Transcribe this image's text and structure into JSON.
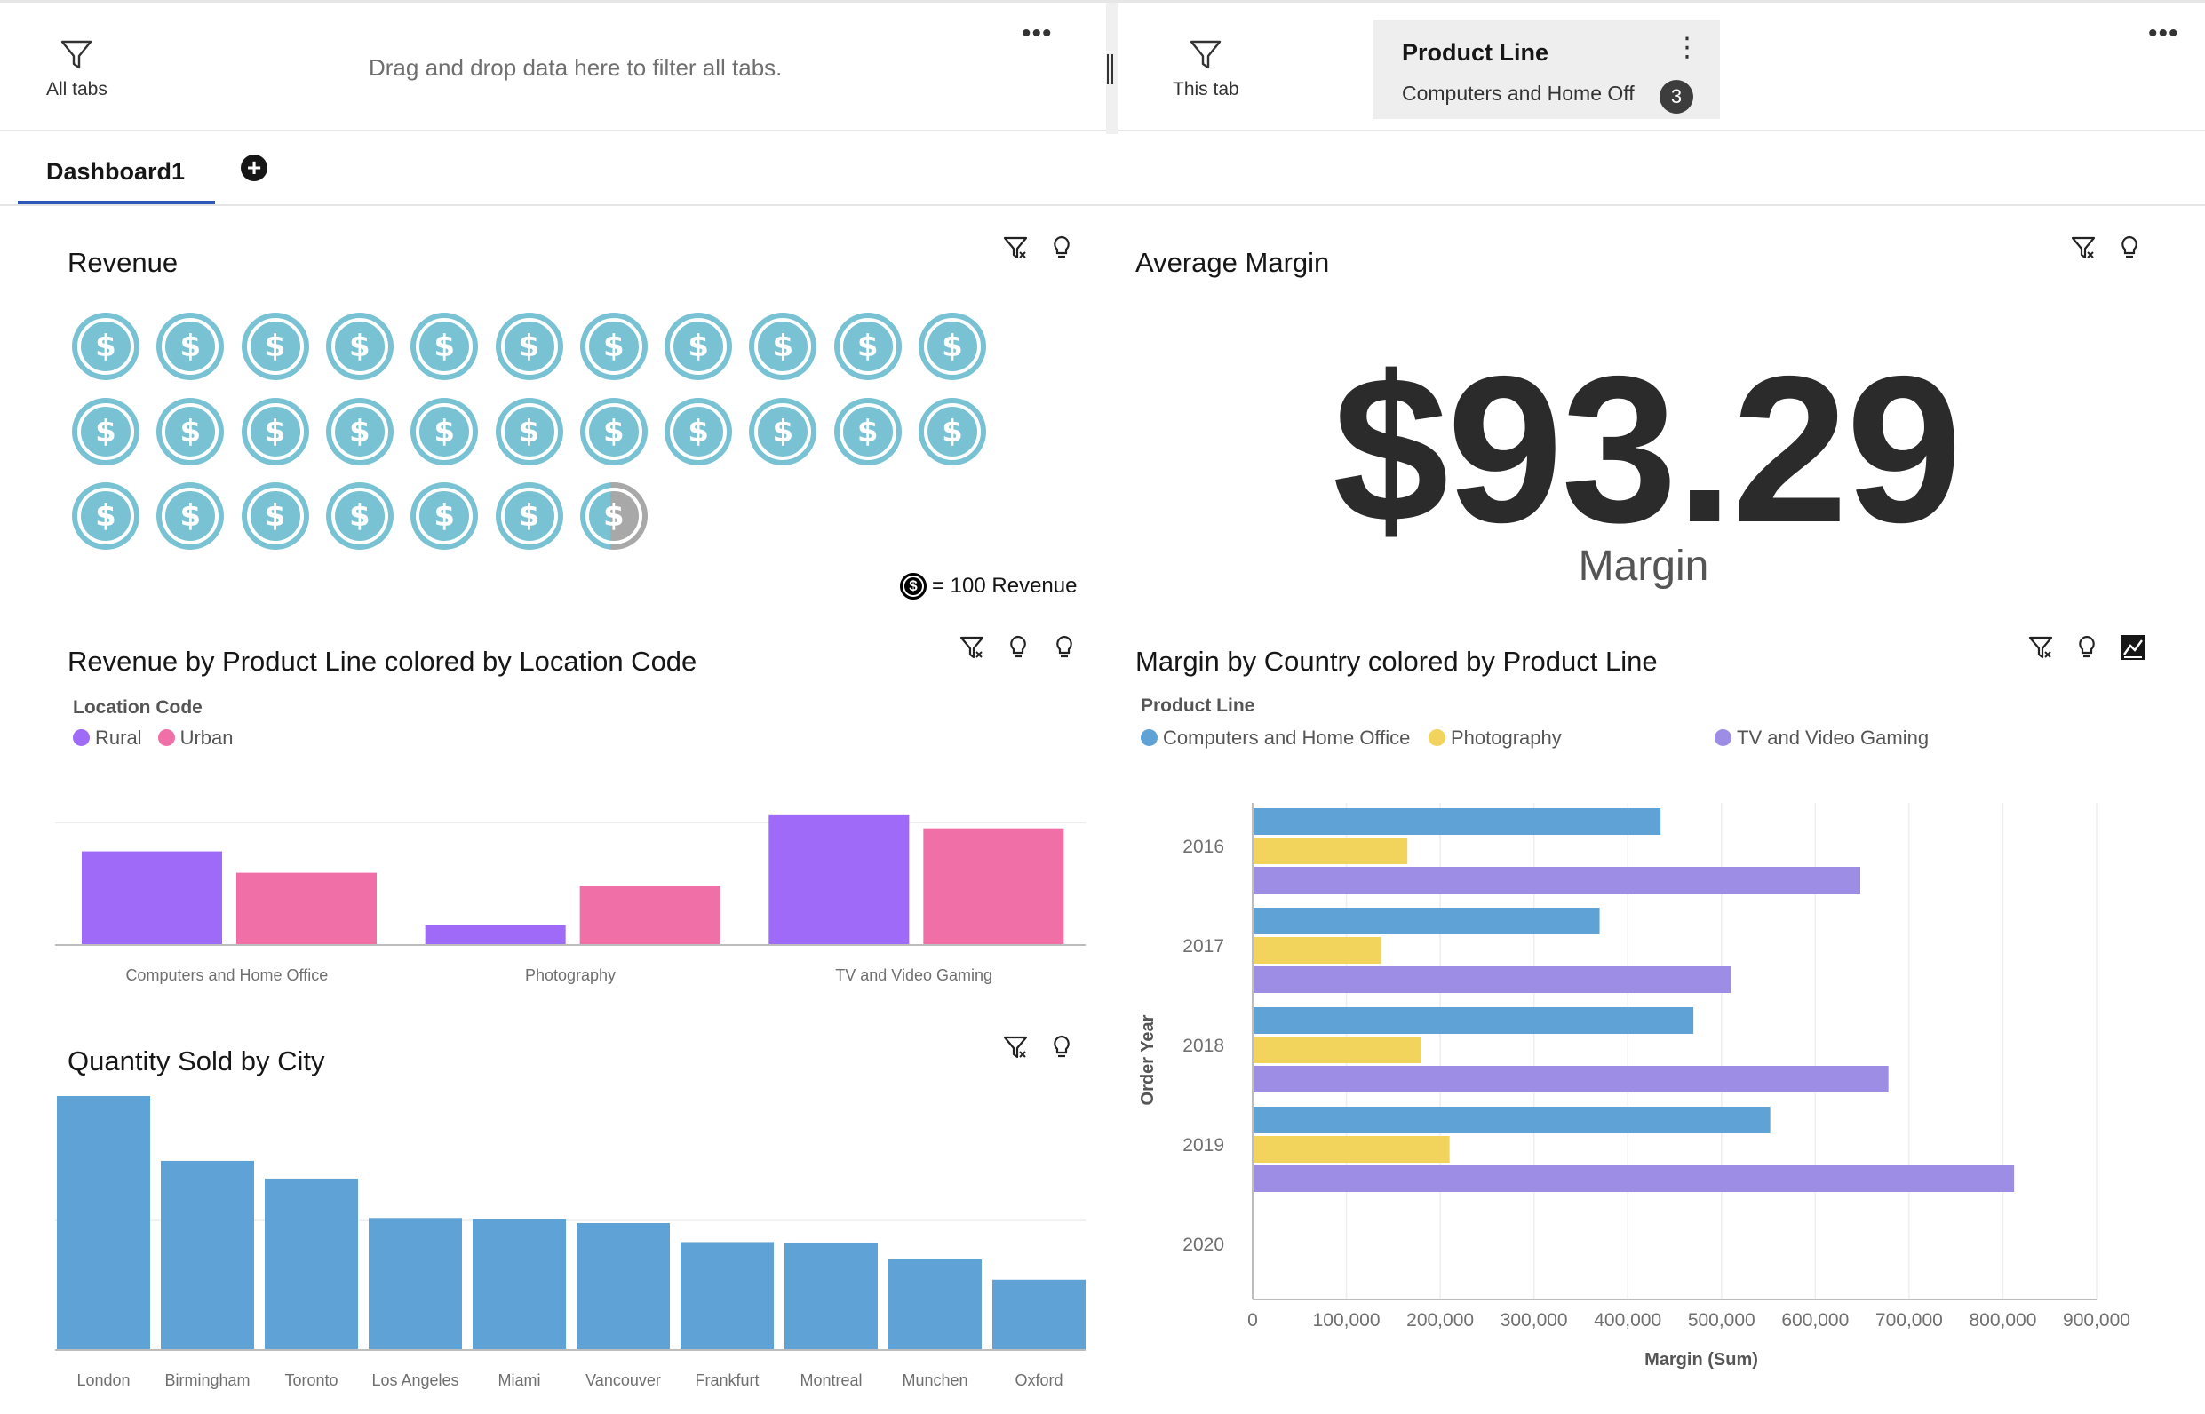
{
  "filter_bar": {
    "all_tabs_label": "All tabs",
    "drop_hint": "Drag and drop data here to filter all tabs.",
    "menu_glyph": "•••",
    "this_tab_label": "This tab",
    "chip": {
      "title": "Product Line",
      "value": "Computers and Home Off",
      "count": "3",
      "menu_glyph": "⋮"
    }
  },
  "tabs": {
    "active": "Dashboard1",
    "add_glyph": "+"
  },
  "revenue_card": {
    "title": "Revenue",
    "coin_glyph": "$",
    "legend_glyph": "$",
    "legend_text": "= 100 Revenue",
    "pictograph": {
      "full_icons": 28,
      "partial_fraction": 0.45,
      "per_row": 11
    }
  },
  "margin_card": {
    "title": "Average Margin",
    "value": "$93.29",
    "label": "Margin"
  },
  "rev_by_product_card": {
    "title": "Revenue by Product Line colored by Location Code",
    "legend_title": "Location Code",
    "chart_data": {
      "type": "bar",
      "categories": [
        "Computers and Home Office",
        "Photography",
        "TV and Video Gaming"
      ],
      "series": [
        {
          "name": "Rural",
          "color": "#9e6af7",
          "values": [
            570,
            120,
            790
          ]
        },
        {
          "name": "Urban",
          "color": "#ef6fa6",
          "values": [
            440,
            360,
            710
          ]
        }
      ],
      "ylim": [
        0,
        800
      ]
    }
  },
  "qty_by_city_card": {
    "title": "Quantity Sold by City",
    "chart_data": {
      "type": "bar",
      "categories": [
        "London",
        "Birmingham",
        "Toronto",
        "Los Angeles",
        "Miami",
        "Vancouver",
        "Frankfurt",
        "Montreal",
        "Munchen",
        "Oxford"
      ],
      "values": [
        1000,
        745,
        675,
        520,
        515,
        500,
        425,
        420,
        357,
        277
      ],
      "color": "#5fa2d6",
      "ylim": [
        0,
        1000
      ]
    }
  },
  "margin_by_country_card": {
    "title": "Margin by Country colored by Product Line",
    "legend_title": "Product Line",
    "chart_data": {
      "type": "bar",
      "orientation": "horizontal",
      "categories": [
        "2016",
        "2017",
        "2018",
        "2019",
        "2020"
      ],
      "series": [
        {
          "name": "Computers and Home Office",
          "color": "#5fa2d6",
          "values": [
            435000,
            370000,
            470000,
            552000,
            0
          ]
        },
        {
          "name": "Photography",
          "color": "#f2d35c",
          "values": [
            165000,
            137000,
            180000,
            210000,
            0
          ]
        },
        {
          "name": "TV and Video Gaming",
          "color": "#9e8de4",
          "values": [
            648000,
            510000,
            678000,
            812000,
            0
          ]
        }
      ],
      "xlim": [
        0,
        900000
      ],
      "xticks": [
        "0",
        "100,000",
        "200,000",
        "300,000",
        "400,000",
        "500,000",
        "600,000",
        "700,000",
        "800,000",
        "900,000"
      ],
      "xlabel": "Margin (Sum)",
      "ylabel": "Order Year"
    }
  }
}
